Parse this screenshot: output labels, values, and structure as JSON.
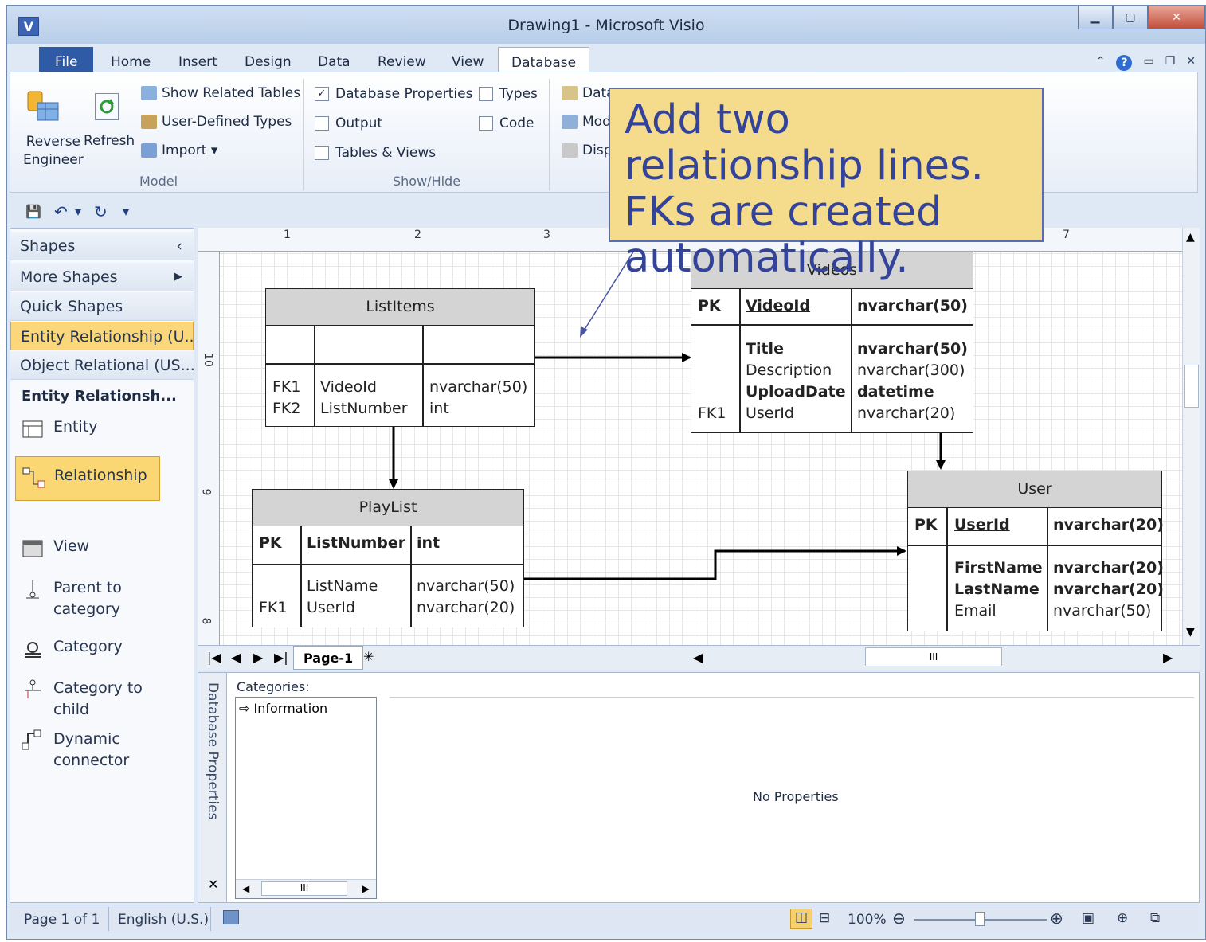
{
  "window": {
    "title": "Drawing1  -  Microsoft Visio",
    "app_icon": "V"
  },
  "ribbon_tabs": [
    "File",
    "Home",
    "Insert",
    "Design",
    "Data",
    "Review",
    "View",
    "Database"
  ],
  "ribbon": {
    "model_group": {
      "reverse_engineer": "Reverse\nEngineer",
      "refresh": "Refresh",
      "show_related_tables": "Show Related Tables",
      "user_defined_types": "User-Defined Types",
      "import": "Import",
      "label": "Model"
    },
    "showhide_group": {
      "database_properties": "Database Properties",
      "types": "Types",
      "output": "Output",
      "code": "Code",
      "tables_views": "Tables & Views",
      "label": "Show/Hide"
    },
    "manage_group": {
      "data": "Data",
      "mod": "Mod",
      "disp": "Disp"
    }
  },
  "callout": "Add two relationship lines. FKs are created automatically.",
  "shapes_panel": {
    "header": "Shapes",
    "items": [
      "More Shapes",
      "Quick Shapes",
      "Entity Relationship (U...",
      "Object Relational (US..."
    ],
    "stencil_title": "Entity Relationsh...",
    "stencils": [
      "Entity",
      "Relationship",
      "View",
      "Parent to category",
      "Category",
      "Category to child",
      "Dynamic connector"
    ]
  },
  "rulers": {
    "top": [
      "1",
      "2",
      "3",
      "7"
    ],
    "left": [
      "10",
      "9",
      "8"
    ]
  },
  "entities": {
    "listitems": {
      "name": "ListItems",
      "rows": [
        {
          "key": "FK1",
          "col": "VideoId",
          "type": "nvarchar(50)"
        },
        {
          "key": "FK2",
          "col": "ListNumber",
          "type": "int"
        }
      ]
    },
    "videos": {
      "name": "Videos",
      "pk": {
        "key": "PK",
        "col": "VideoId",
        "type": "nvarchar(50)"
      },
      "rows": [
        {
          "key": "",
          "col": "Title",
          "type": "nvarchar(50)"
        },
        {
          "key": "",
          "col": "Description",
          "type": "nvarchar(300)"
        },
        {
          "key": "",
          "col": "UploadDate",
          "type": "datetime"
        },
        {
          "key": "FK1",
          "col": "UserId",
          "type": "nvarchar(20)"
        }
      ]
    },
    "playlist": {
      "name": "PlayList",
      "pk": {
        "key": "PK",
        "col": "ListNumber",
        "type": "int"
      },
      "rows": [
        {
          "key": "",
          "col": "ListName",
          "type": "nvarchar(50)"
        },
        {
          "key": "FK1",
          "col": "UserId",
          "type": "nvarchar(20)"
        }
      ]
    },
    "user": {
      "name": "User",
      "pk": {
        "key": "PK",
        "col": "UserId",
        "type": "nvarchar(20)"
      },
      "rows": [
        {
          "key": "",
          "col": "FirstName",
          "type": "nvarchar(20)"
        },
        {
          "key": "",
          "col": "LastName",
          "type": "nvarchar(20)"
        },
        {
          "key": "",
          "col": "Email",
          "type": "nvarchar(50)"
        }
      ]
    }
  },
  "page_tab": "Page-1",
  "properties": {
    "side_title": "Database Properties",
    "categories_label": "Categories:",
    "category_item": "Information",
    "message": "No Properties"
  },
  "status": {
    "page": "Page 1 of 1",
    "language": "English (U.S.)",
    "zoom": "100%"
  }
}
